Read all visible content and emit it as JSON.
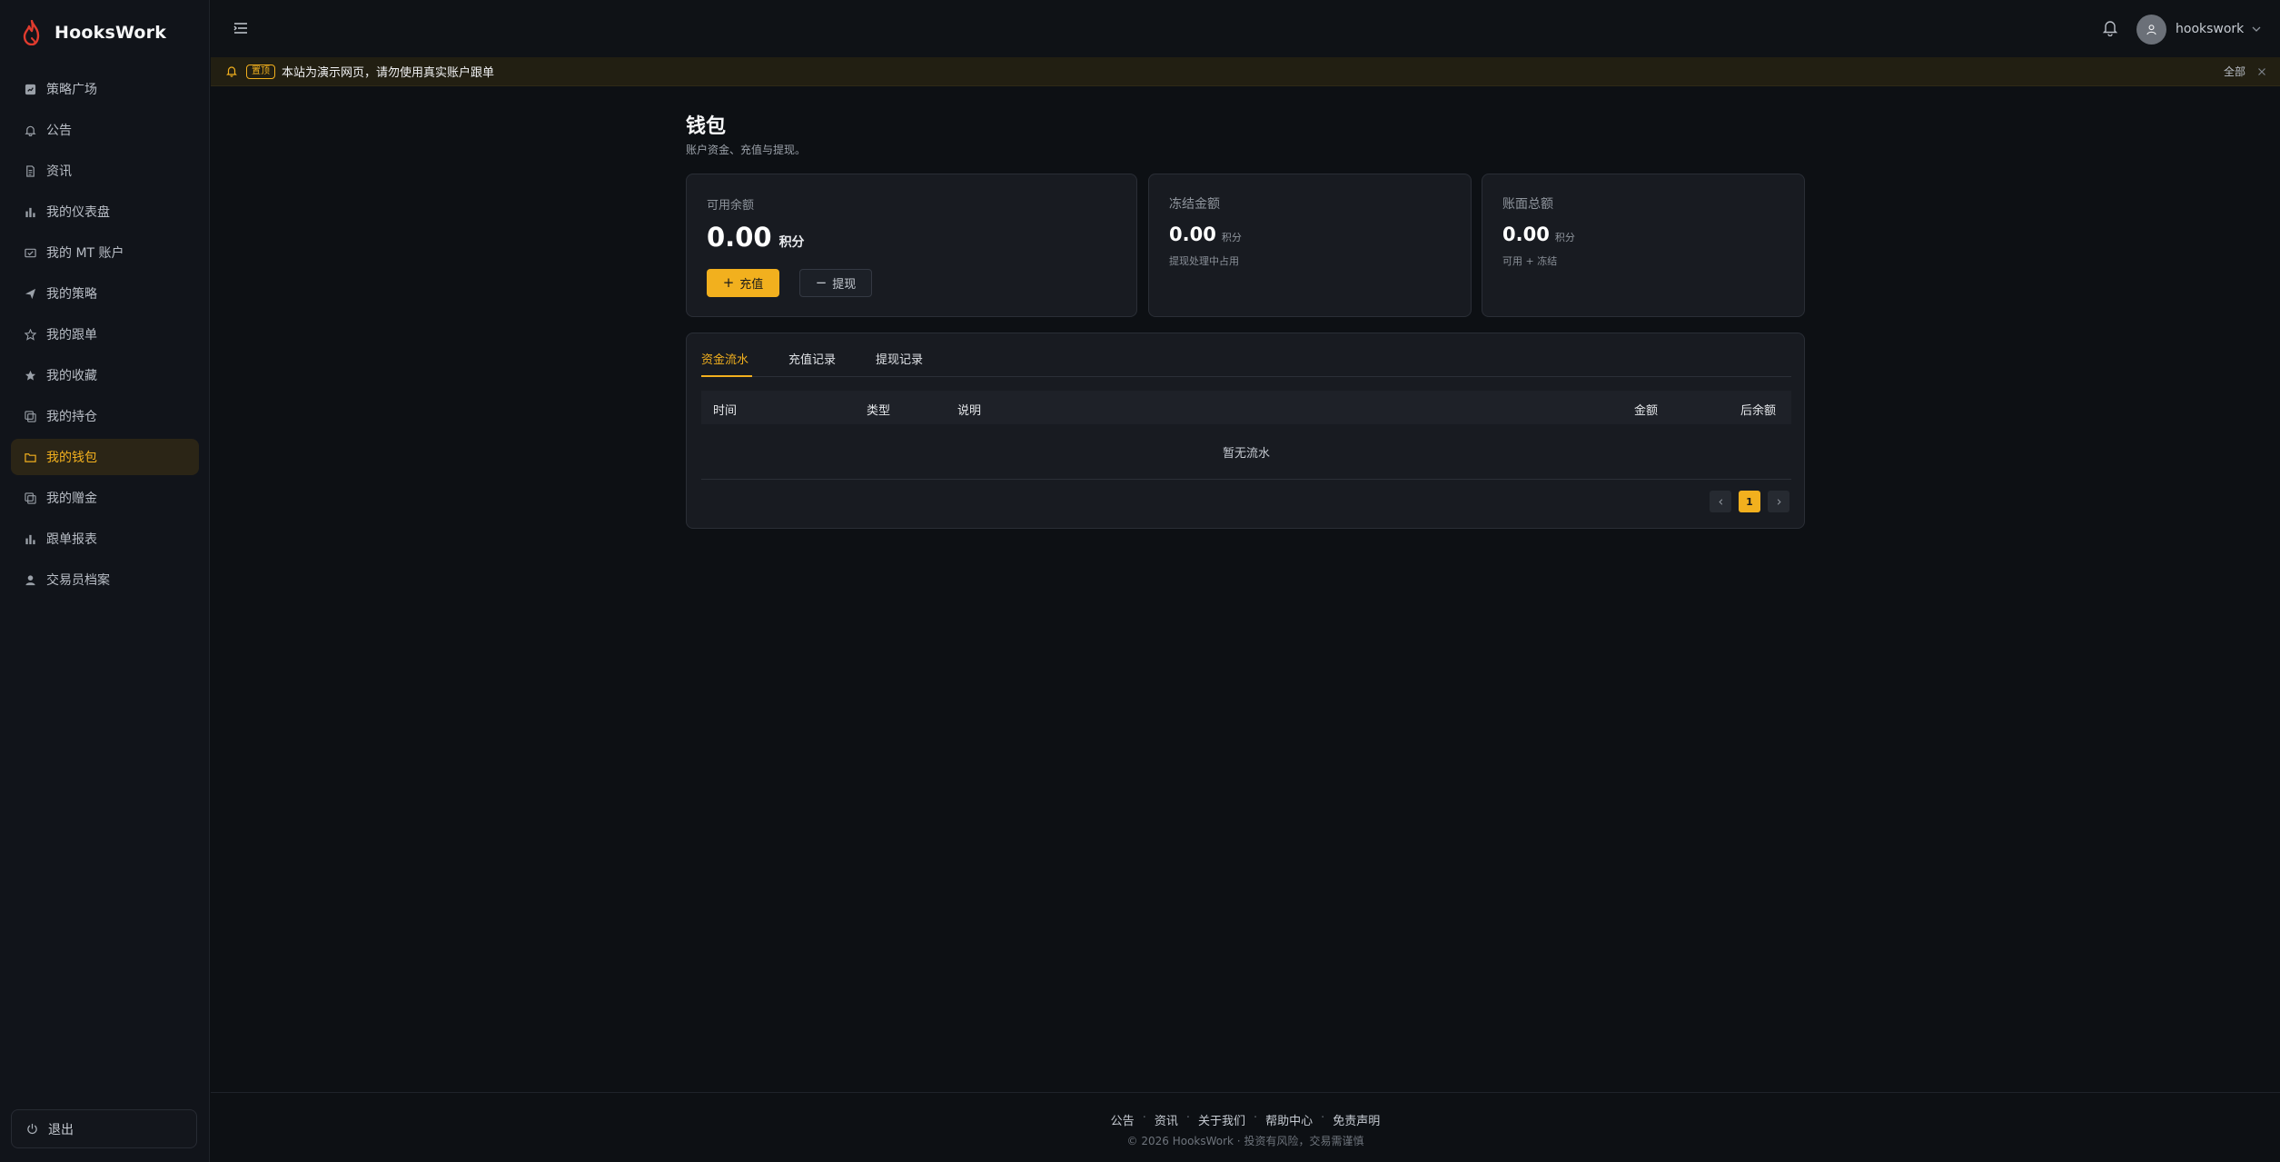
{
  "brand": {
    "name": "HooksWork"
  },
  "sidebar": {
    "items": [
      {
        "label": "策略广场",
        "icon": "square-chart-icon"
      },
      {
        "label": "公告",
        "icon": "bell-icon"
      },
      {
        "label": "资讯",
        "icon": "document-icon"
      },
      {
        "label": "我的仪表盘",
        "icon": "bar-chart-icon"
      },
      {
        "label": "我的 MT 账户",
        "icon": "account-check-icon"
      },
      {
        "label": "我的策略",
        "icon": "send-icon"
      },
      {
        "label": "我的跟单",
        "icon": "star-outline-icon"
      },
      {
        "label": "我的收藏",
        "icon": "star-filled-icon"
      },
      {
        "label": "我的持仓",
        "icon": "copy-icon"
      },
      {
        "label": "我的钱包",
        "icon": "wallet-icon",
        "active": true
      },
      {
        "label": "我的赠金",
        "icon": "copy-icon"
      },
      {
        "label": "跟单报表",
        "icon": "bar-chart-icon"
      },
      {
        "label": "交易员档案",
        "icon": "user-icon"
      }
    ],
    "logout_label": "退出"
  },
  "header": {
    "username": "hookswork"
  },
  "notice": {
    "tag": "置顶",
    "text": "本站为演示网页，请勿使用真实账户跟单",
    "all_label": "全部"
  },
  "page": {
    "title": "钱包",
    "subtitle": "账户资金、充值与提现。"
  },
  "cards": {
    "available": {
      "label": "可用余额",
      "value": "0.00",
      "unit": "积分",
      "recharge_label": "充值",
      "withdraw_label": "提现"
    },
    "frozen": {
      "label": "冻结金额",
      "value": "0.00",
      "unit": "积分",
      "note": "提现处理中占用"
    },
    "total": {
      "label": "账面总额",
      "value": "0.00",
      "unit": "积分",
      "note": "可用 + 冻结"
    }
  },
  "records": {
    "tabs": [
      "资金流水",
      "充值记录",
      "提现记录"
    ],
    "active_tab": 0,
    "columns": {
      "time": "时间",
      "type": "类型",
      "desc": "说明",
      "amount": "金额",
      "balance": "后余额"
    },
    "empty_text": "暂无流水",
    "pagination": {
      "current": "1"
    }
  },
  "footer": {
    "links": [
      "公告",
      "资讯",
      "关于我们",
      "帮助中心",
      "免责声明"
    ],
    "copyright": "© 2026 HooksWork · 投资有风险，交易需谨慎"
  },
  "colors": {
    "accent": "#f2b01e",
    "background": "#0d1014",
    "sidebar": "#11141a",
    "card": "#181b21"
  }
}
